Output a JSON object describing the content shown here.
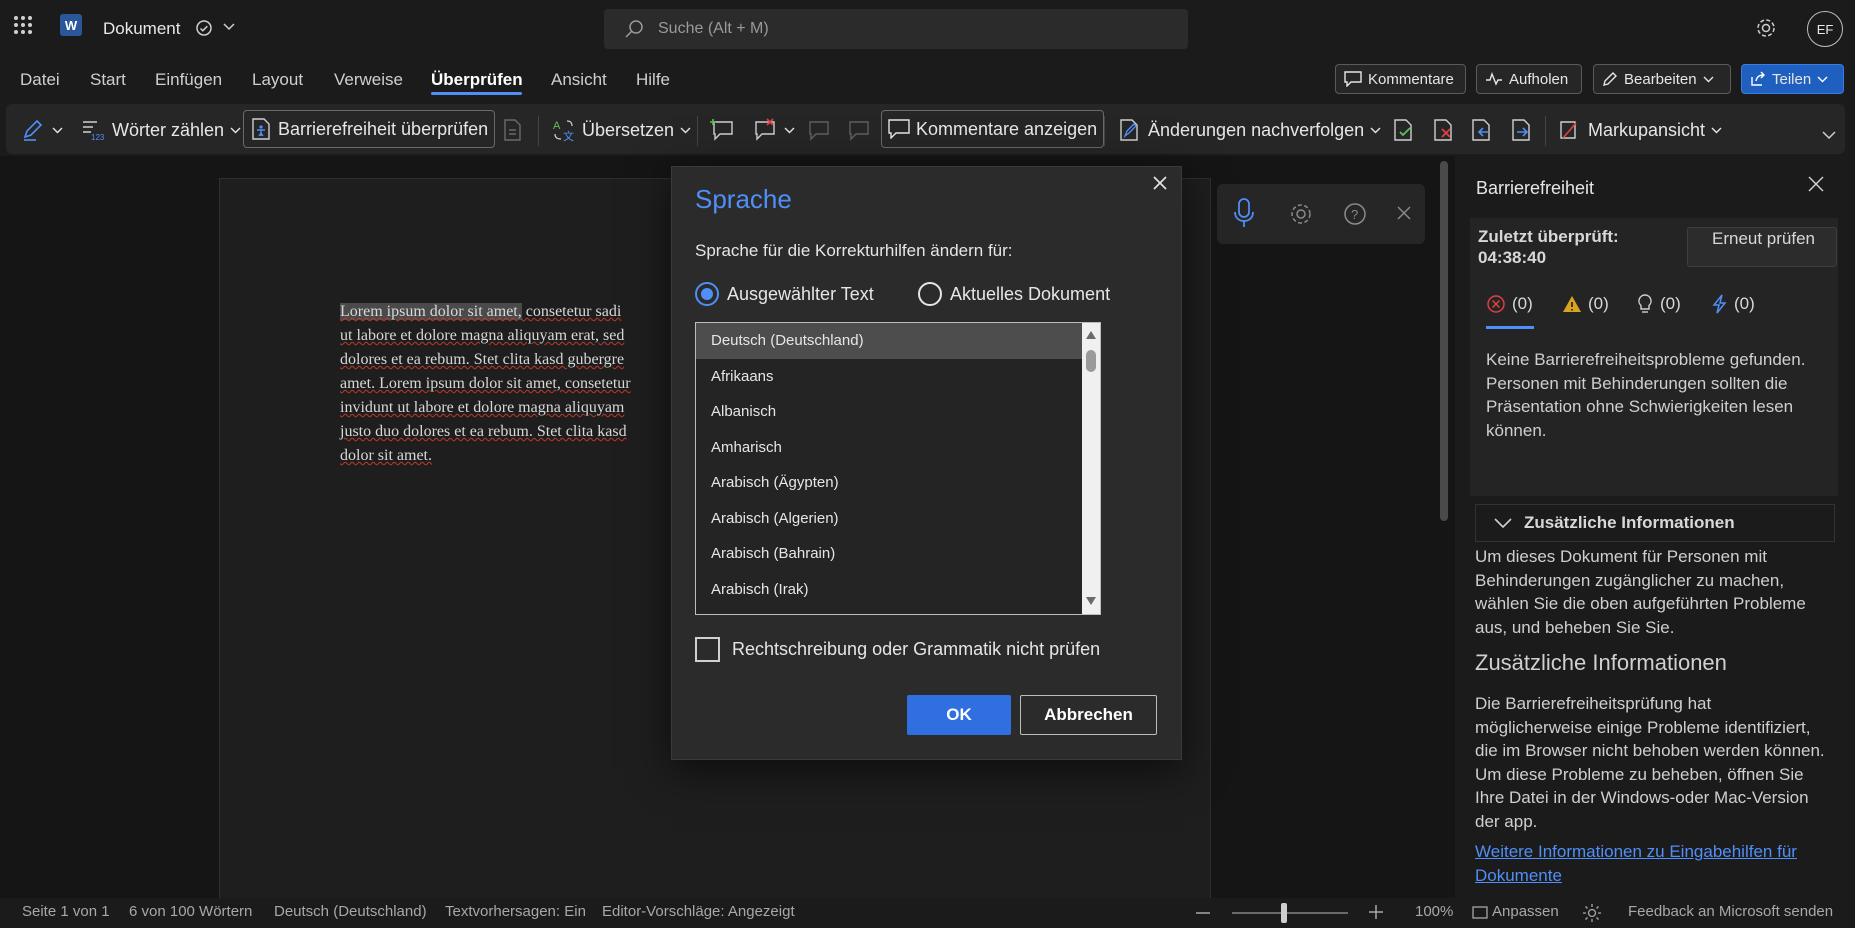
{
  "titlebar": {
    "app_logo": "W",
    "doc_title": "Dokument",
    "search_placeholder": "Suche (Alt + M)",
    "avatar": "EF",
    "icons": [
      "waffle-icon",
      "word-logo-icon",
      "cloud-saved-icon",
      "chevron-down-icon",
      "search-icon",
      "gear-icon"
    ]
  },
  "menu": {
    "tabs": [
      "Datei",
      "Start",
      "Einfügen",
      "Layout",
      "Verweise",
      "Überprüfen",
      "Ansicht",
      "Hilfe"
    ],
    "active_tab": "Überprüfen",
    "buttons": {
      "comments": "Kommentare",
      "catchup": "Aufholen",
      "edit": "Bearbeiten",
      "share": "Teilen"
    }
  },
  "ribbon": {
    "word_count": "Wörter zählen",
    "accessibility_check": "Barrierefreiheit überprüfen",
    "translate": "Übersetzen",
    "show_comments": "Kommentare anzeigen",
    "track_changes": "Änderungen nachverfolgen",
    "markup_view": "Markupansicht"
  },
  "document": {
    "lines": [
      [
        "Lorem ipsum dolor sit amet,",
        " consetetur sadi"
      ],
      [
        "ut labore et dolore magna aliquyam erat, sed"
      ],
      [
        "dolores et ea rebum. Stet clita kasd gubergre"
      ],
      [
        "amet. Lorem ipsum dolor sit amet, consetetur"
      ],
      [
        "invidunt ut labore et dolore magna aliquyam"
      ],
      [
        "justo duo dolores et ea rebum. Stet clita kasd"
      ],
      [
        "dolor sit amet."
      ]
    ]
  },
  "dialog": {
    "title": "Sprache",
    "prompt": "Sprache für die Korrekturhilfen ändern für:",
    "radio_selected_text": "Ausgewählter Text",
    "radio_current_doc": "Aktuelles Dokument",
    "selected_option": "Ausgewählter Text",
    "languages": [
      "Deutsch (Deutschland)",
      "Afrikaans",
      "Albanisch",
      "Amharisch",
      "Arabisch (Ägypten)",
      "Arabisch (Algerien)",
      "Arabisch (Bahrain)",
      "Arabisch (Irak)"
    ],
    "selected_language": "Deutsch (Deutschland)",
    "no_proofing_label": "Rechtschreibung oder Grammatik nicht prüfen",
    "no_proofing_checked": false,
    "ok": "OK",
    "cancel": "Abbrechen"
  },
  "pane": {
    "title": "Barrierefreiheit",
    "last_checked_label": "Zuletzt überprüft:",
    "last_checked_time": "04:38:40",
    "recheck": "Erneut prüfen",
    "counts": {
      "errors": "(0)",
      "warnings": "(0)",
      "tips": "(0)",
      "intelligent": "(0)"
    },
    "message": "Keine Barrierefreiheitsprobleme gefunden. Personen mit Behinderungen sollten die Präsentation ohne Schwierigkeiten lesen können.",
    "accordion": "Zusätzliche Informationen",
    "accordion_body": "Um dieses Dokument für Personen mit Behinderungen zugänglicher zu machen, wählen Sie die oben aufgeführten Probleme aus, und beheben Sie Sie.",
    "heading": "Zusätzliche Informationen",
    "body": "Die Barrierefreiheitsprüfung hat möglicherweise einige Probleme identifiziert, die im Browser nicht behoben werden können. Um diese Probleme zu beheben, öffnen Sie Ihre Datei in der Windows-oder Mac-Version der app.",
    "link": "Weitere Informationen zu Eingabehilfen für Dokumente"
  },
  "status": {
    "page": "Seite 1 von 1",
    "words": "6 von 100 Wörtern",
    "language": "Deutsch (Deutschland)",
    "predictions": "Textvorhersagen: Ein",
    "editor": "Editor-Vorschläge: Angezeigt",
    "zoom": "100%",
    "fit": "Anpassen",
    "feedback": "Feedback an Microsoft senden",
    "zoom_level": 0.45
  },
  "colors": {
    "accent": "#4f8ff7",
    "ok_button": "#2f6fe0",
    "share_button": "#1f5fbf"
  }
}
